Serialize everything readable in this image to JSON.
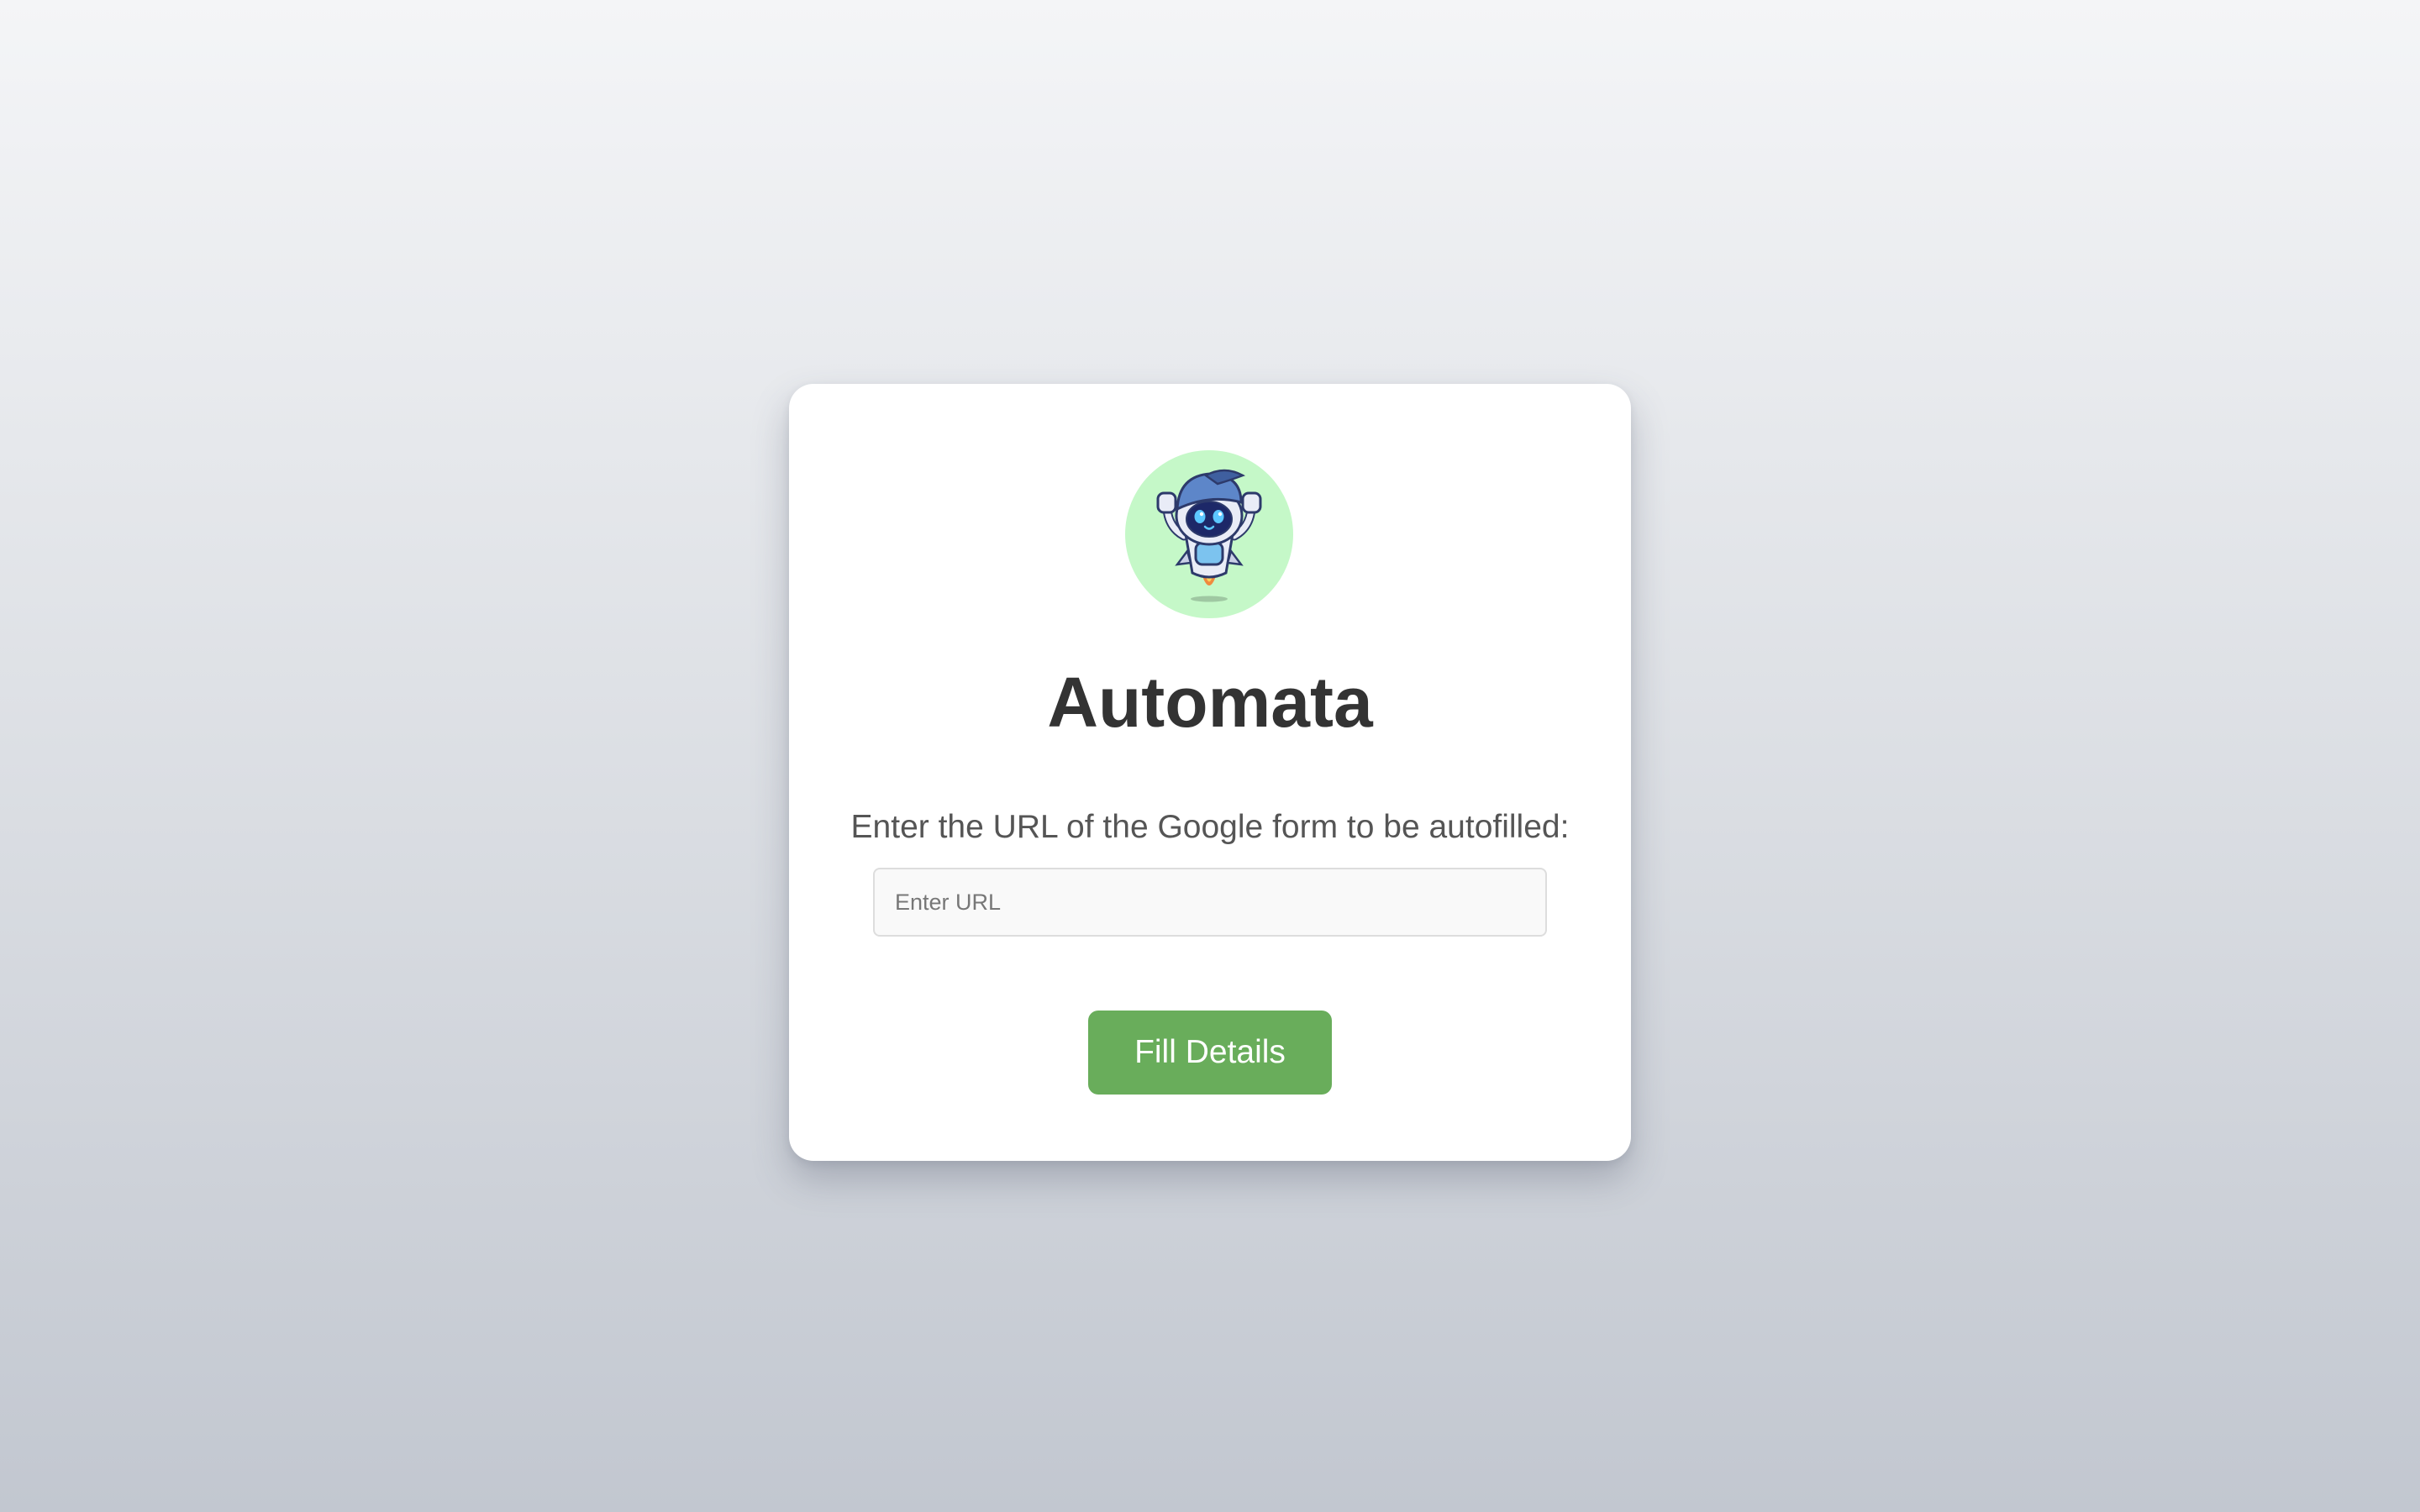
{
  "app": {
    "title": "Automata",
    "prompt": "Enter the URL of the Google form to be autofilled:"
  },
  "logo": {
    "icon": "robot-mascot-icon",
    "background_color": "#c5f8c8"
  },
  "url_input": {
    "value": "",
    "placeholder": "Enter URL"
  },
  "submit": {
    "label": "Fill Details",
    "color": "#69ad5b"
  }
}
